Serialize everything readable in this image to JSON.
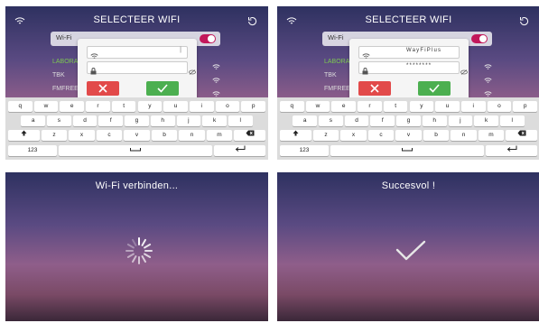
{
  "screen": {
    "title": "SELECTEER WIFI",
    "wifi_label": "Wi-Fi",
    "networks": [
      "LABORA",
      "TBK",
      "FMFREE"
    ],
    "dialog": {
      "ssid_value_empty": "",
      "ssid_caret": "|",
      "ssid_value_filled": "WayFiPlus",
      "password_value_empty": "",
      "password_value_filled": "********"
    },
    "keyboard": {
      "row1": [
        "q",
        "w",
        "e",
        "r",
        "t",
        "y",
        "u",
        "i",
        "o",
        "p"
      ],
      "row2": [
        "a",
        "s",
        "d",
        "f",
        "g",
        "h",
        "j",
        "k",
        "l"
      ],
      "row3": [
        "z",
        "x",
        "c",
        "v",
        "b",
        "n",
        "m"
      ],
      "mode_key": "123"
    }
  },
  "connecting_message": "Wi-Fi verbinden...",
  "success_message": "Succesvol !",
  "colors": {
    "toggle_on": "#c2185b",
    "cancel": "#e24a4a",
    "confirm": "#4caf50",
    "active_network": "#7ec850"
  }
}
